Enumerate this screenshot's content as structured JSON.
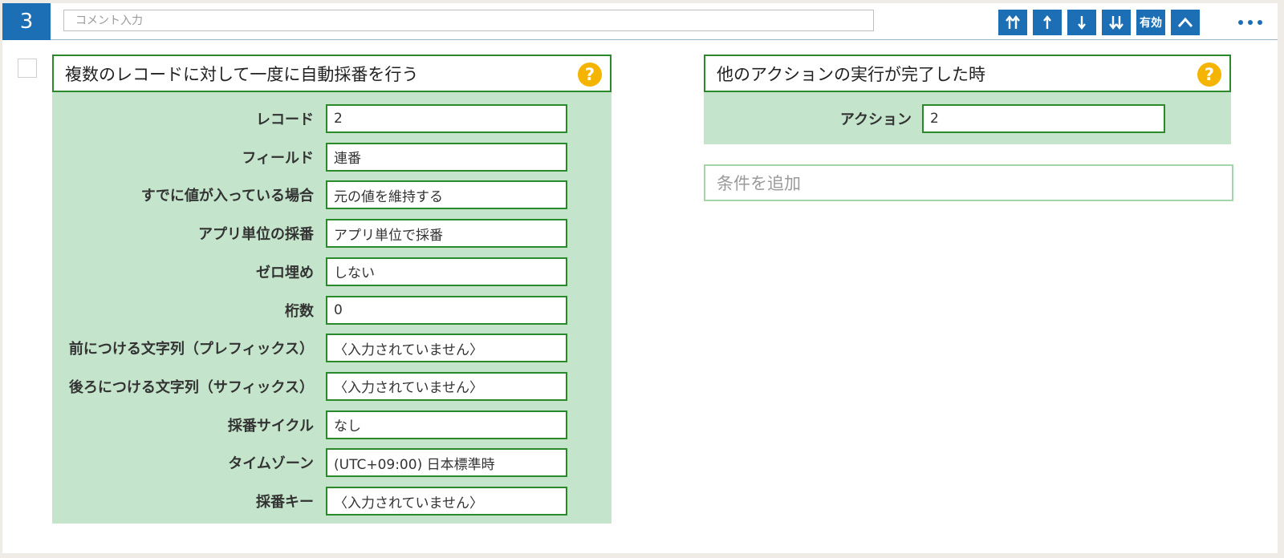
{
  "step": {
    "number": "3"
  },
  "comment": {
    "placeholder": "コメント入力",
    "value": ""
  },
  "toolbar": {
    "move_top_icon": "move-to-top",
    "move_up_icon": "move-up",
    "move_down_icon": "move-down",
    "move_bottom_icon": "move-to-bottom",
    "enabled_label": "有効",
    "collapse_icon": "chevron-up",
    "more_icon": "ellipsis"
  },
  "colors": {
    "accent_blue": "#1c6fb5",
    "panel_border_green": "#2a8a2a",
    "panel_fill_green": "#c4e5cc",
    "help_yellow": "#f5b400"
  },
  "action_panel": {
    "title": "複数のレコードに対して一度に自動採番を行う",
    "help": "?",
    "fields": [
      {
        "label": "レコード",
        "value": "2"
      },
      {
        "label": "フィールド",
        "value": "連番"
      },
      {
        "label": "すでに値が入っている場合",
        "value": "元の値を維持する"
      },
      {
        "label": "アプリ単位の採番",
        "value": "アプリ単位で採番"
      },
      {
        "label": "ゼロ埋め",
        "value": "しない"
      },
      {
        "label": "桁数",
        "value": "0"
      },
      {
        "label": "前につける文字列（プレフィックス）",
        "value": "〈入力されていません〉"
      },
      {
        "label": "後ろにつける文字列（サフィックス）",
        "value": "〈入力されていません〉"
      },
      {
        "label": "採番サイクル",
        "value": "なし"
      },
      {
        "label": "タイムゾーン",
        "value": "(UTC+09:00) 日本標準時"
      },
      {
        "label": "採番キー",
        "value": "〈入力されていません〉"
      }
    ]
  },
  "trigger_panel": {
    "title": "他のアクションの実行が完了した時",
    "help": "?",
    "fields": [
      {
        "label": "アクション",
        "value": "2"
      }
    ],
    "add_condition": "条件を追加"
  }
}
